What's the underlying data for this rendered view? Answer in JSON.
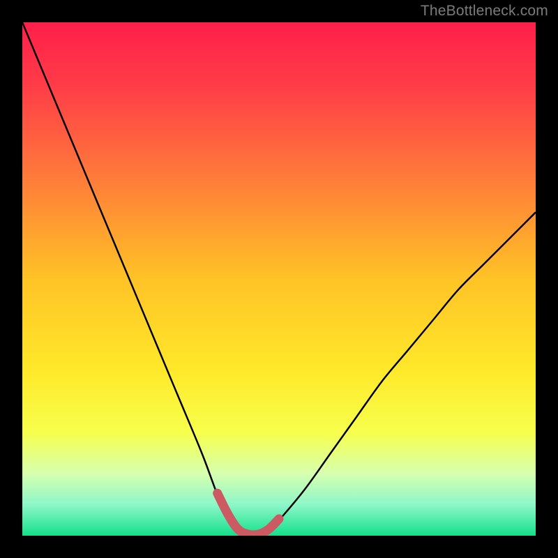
{
  "watermark": "TheBottleneck.com",
  "chart_data": {
    "type": "line",
    "title": "",
    "xlabel": "",
    "ylabel": "",
    "xlim": [
      0,
      100
    ],
    "ylim": [
      0,
      100
    ],
    "series": [
      {
        "name": "bottleneck-curve",
        "x": [
          0,
          5,
          10,
          15,
          20,
          25,
          30,
          35,
          38,
          40,
          42,
          44,
          46,
          48,
          50,
          55,
          60,
          65,
          70,
          75,
          80,
          85,
          90,
          95,
          100
        ],
        "y": [
          100,
          88,
          76,
          64,
          52,
          40,
          28,
          16,
          8,
          4,
          1,
          0,
          0,
          1,
          3,
          9,
          16,
          23,
          30,
          36,
          42,
          48,
          53,
          58,
          63
        ]
      }
    ],
    "annotations": [
      {
        "name": "optimal-range",
        "x_start": 40,
        "x_end": 50,
        "y": 0
      }
    ],
    "gradient_stops": [
      {
        "offset": 0.0,
        "color": "#ff1f4a"
      },
      {
        "offset": 0.12,
        "color": "#ff3b48"
      },
      {
        "offset": 0.3,
        "color": "#ff7a3a"
      },
      {
        "offset": 0.5,
        "color": "#ffc326"
      },
      {
        "offset": 0.68,
        "color": "#ffe92a"
      },
      {
        "offset": 0.8,
        "color": "#f7ff4d"
      },
      {
        "offset": 0.88,
        "color": "#d6ffb0"
      },
      {
        "offset": 0.94,
        "color": "#8cf7c8"
      },
      {
        "offset": 1.0,
        "color": "#13e08a"
      }
    ],
    "colors": {
      "curve": "#000000",
      "marker": "#cc5a62",
      "frame": "#000000"
    }
  }
}
